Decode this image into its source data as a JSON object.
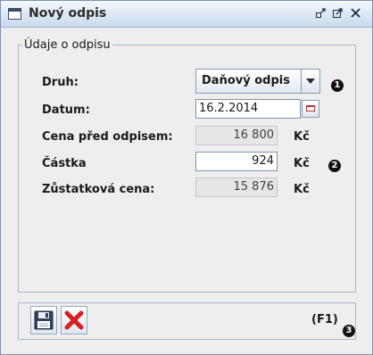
{
  "window": {
    "title": "Nový odpis",
    "icon": "window-icon",
    "controls": [
      "minimize-icon",
      "maximize-icon",
      "close-icon"
    ]
  },
  "group": {
    "legend": "Údaje o odpisu"
  },
  "form": {
    "druh": {
      "label": "Druh:",
      "value": "Daňový odpis"
    },
    "datum": {
      "label": "Datum:",
      "value": "16.2.2014"
    },
    "cena_pred": {
      "label": "Cena před odpisem:",
      "value": "16 800",
      "unit": "Kč"
    },
    "castka": {
      "label": "Částka",
      "value": "924",
      "unit": "Kč"
    },
    "zustatkova": {
      "label": "Zůstatková cena:",
      "value": "15 876",
      "unit": "Kč"
    }
  },
  "badges": {
    "b1": "1",
    "b2": "2",
    "b3": "3"
  },
  "toolbar": {
    "save_icon": "floppy-save-icon",
    "cancel_icon": "red-x-cancel-icon",
    "shortcut": "(F1)"
  }
}
